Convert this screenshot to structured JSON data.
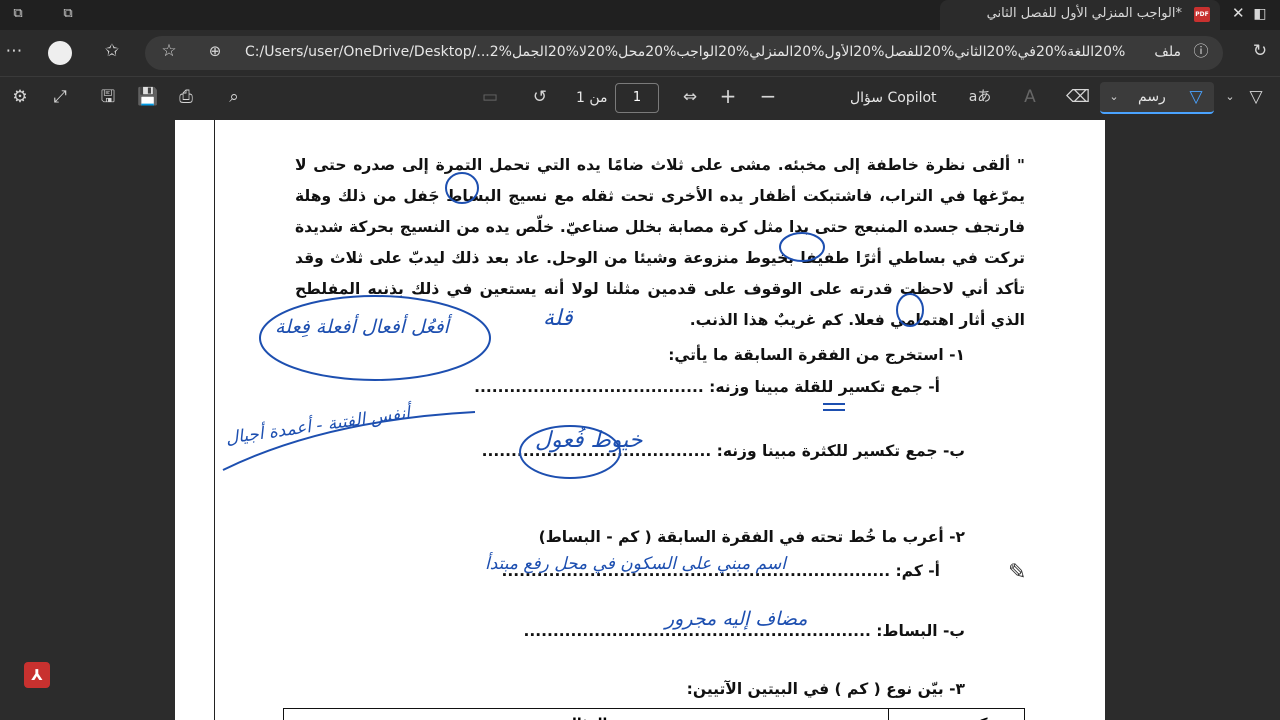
{
  "tab": {
    "title": "*الواجب المنزلي الأول للفصل الثاني",
    "badge": "PDF"
  },
  "address": {
    "file_label": "ملف",
    "url": "C:/Users/user/OneDrive/Desktop/...2%مادة%20اللغة%20في%20الثاني%20للفصل%20الأول%20المنزلي%20الواجب%20محل%20لا%20الجمل"
  },
  "toolbar": {
    "draw_label": "رسم",
    "copilot_label": "سؤال Copilot",
    "page_current": "1",
    "page_of": "من 1"
  },
  "document": {
    "paragraph": "\" ألقى نظرة خاطفة إلى مخبئه. مشى على ثلاث ضامًا يده التي تحمل التمرة إلى صدره حتى لا يمرّغها في التراب، فاشتبكت أظفار يده الأخرى تحت ثقله مع نسيج البساط جَفل من ذلك وهلة فارتجف جسده المنبعج حتى بدا مثل كرة مصابة بخلل صناعيّ. خلّص يده من النسيج بحركة شديدة تركت في بساطي أثرًا طفيفا بخيوط منزوعة وشيئا من الوحل. عاد بعد ذلك ليدبّ على ثلاث وقد تأكد أني لاحظت قدرته على الوقوف على قدمين مثلنا لولا أنه يستعين في ذلك بذنبه المفلطح الذي أثار اهتمامي فعلا. كم غريبٌ هذا الذنب.",
    "q1": "١- استخرج من الفقرة السابقة ما يأتي:",
    "q1a": "أ-  جمع تكسير للقلة مبينا وزنه: .......................................",
    "q1b": "ب- جمع تكسير للكثرة مبينا وزنه: .......................................",
    "q2": "٢- أعرب ما خُط تحته في الفقرة السابقة ( كم -  البساط)",
    "q2a": "أ-  كم: ..................................................................",
    "q2b": "ب- البساط: ...........................................................",
    "q3": "٣- بيّن نوع ( كم ) في البيتين الآتيين:",
    "table_headers": [
      "المثال",
      "نوع كم"
    ]
  },
  "handwriting": {
    "qilla": "قلة",
    "patterns": "أفعُل  أفعال  أفعلة  فِعلة",
    "examples": "أنفس الفتية - أعمدة أجيال",
    "khuyut": "خيوط  فُعول",
    "kam_irab": "اسم مبني على السكون في محل رفع مبتدأ",
    "bisat_irab": "مضاف إليه مجرور"
  }
}
